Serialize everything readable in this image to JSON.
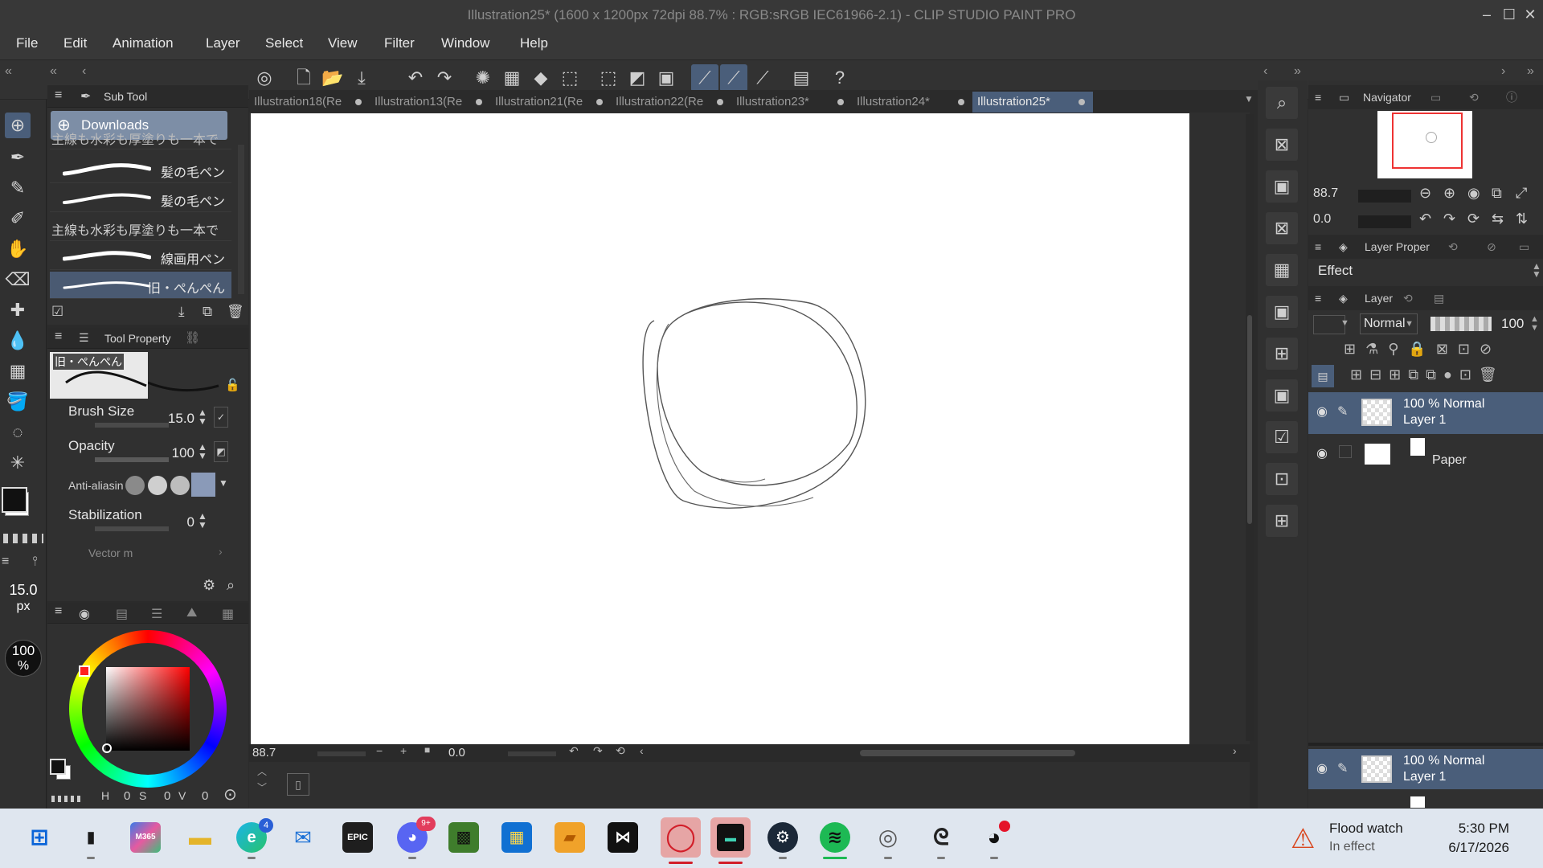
{
  "window": {
    "title": "Illustration25* (1600 x 1200px 72dpi 88.7% : RGB:sRGB IEC61966-2.1) - CLIP STUDIO PAINT PRO",
    "controls": [
      "–",
      "☐",
      "✕"
    ]
  },
  "menu": [
    "File",
    "Edit",
    "Animation",
    "Layer",
    "Select",
    "View",
    "Filter",
    "Window",
    "Help"
  ],
  "tabs": [
    {
      "label": "Illustration18(Re",
      "active": false
    },
    {
      "label": "Illustration13(Re",
      "active": false
    },
    {
      "label": "Illustration21(Re",
      "active": false
    },
    {
      "label": "Illustration22(Re",
      "active": false
    },
    {
      "label": "Illustration23*",
      "active": false
    },
    {
      "label": "Illustration24*",
      "active": false
    },
    {
      "label": "Illustration25*",
      "active": true
    }
  ],
  "subtool": {
    "header": "Sub Tool",
    "group": "Downloads",
    "brushes": [
      {
        "label": "主線も水彩も厚塗りも一本で",
        "selected": false
      },
      {
        "label": "髪の毛ペン",
        "selected": false
      },
      {
        "label": "髪の毛ペン",
        "selected": false
      },
      {
        "label": "主線も水彩も厚塗りも一本で",
        "selected": false
      },
      {
        "label": "線画用ペン",
        "selected": false
      },
      {
        "label": "旧・ぺんぺん",
        "selected": true
      }
    ]
  },
  "tool_property": {
    "header": "Tool Property",
    "preset_name": "旧・ぺんぺん",
    "brush_size_label": "Brush Size",
    "brush_size_value": "15.0",
    "opacity_label": "Opacity",
    "opacity_value": "100",
    "antialias_label": "Anti-aliasin",
    "stabilization_label": "Stabilization",
    "stabilization_value": "0",
    "vector_label": "Vector m"
  },
  "left_indicators": {
    "size": "15.0",
    "size_unit": "px",
    "opacity": "100",
    "opacity_unit": "%"
  },
  "color": {
    "main": "#111111",
    "sub": "#ffffff",
    "hsv_h": "H",
    "hsv_h_val": "0",
    "hsv_s": "S",
    "hsv_s_val": "0",
    "hsv_v": "V",
    "hsv_v_val": "0"
  },
  "canvas_status": {
    "zoom": "88.7",
    "rotation": "0.0"
  },
  "navigator": {
    "header": "Navigator",
    "zoom": "88.7",
    "rotation": "0.0"
  },
  "layer_property": {
    "header": "Layer Proper",
    "effect_label": "Effect"
  },
  "layer_panel": {
    "header": "Layer",
    "blend_mode": "Normal",
    "opacity": "100",
    "layers": [
      {
        "mode_line": "100 % Normal",
        "name": "Layer 1",
        "selected": true
      },
      {
        "mode_line": "",
        "name": "Paper",
        "selected": false
      }
    ],
    "bottom_layer": {
      "mode_line": "100 % Normal",
      "name": "Layer 1"
    }
  },
  "taskbar": {
    "apps": [
      "windows",
      "terminal",
      "microsoft-365",
      "file-explorer",
      "edge",
      "outlook",
      "epic-games",
      "discord",
      "minecraft",
      "store",
      "presentation",
      "capcut",
      "opera",
      "terminal-dark",
      "steam",
      "spotify",
      "clip-studio",
      "clip-studio-2",
      "blender"
    ],
    "discord_badge": "9+",
    "edge_badge": "4",
    "weather_title": "Flood watch",
    "weather_sub": "In effect",
    "time": "5:30 PM",
    "date": "6/17/2026"
  }
}
